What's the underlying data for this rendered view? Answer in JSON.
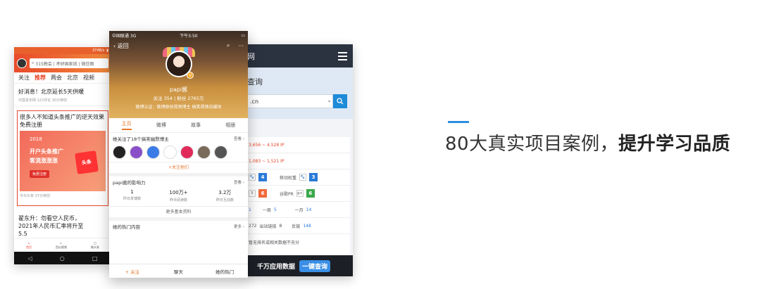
{
  "phone_left": {
    "status_speed": "374B/s",
    "search_text": "315晚会 | 考研国家线 | 微信图",
    "tabs": [
      "关注",
      "推荐",
      "两会",
      "北京",
      "视频"
    ],
    "news1_title": "好消息！北京延长5天供暖",
    "news1_meta": "中国青年网 122评论 30分钟前",
    "ad_title": "很多人不知道头条推广的逆天效果免费注册",
    "ad_year": "2018",
    "ad_line1": "开户头条推广",
    "ad_line2": "客流涨涨涨",
    "ad_button": "免费注册",
    "ad_cube": "头条",
    "ad_meta": "今日头条 37分钟前",
    "news2_title": "翟东升：勿看空人民币，2021年人民币汇率将升至5.5",
    "nav": [
      "首页",
      "西瓜视频",
      "微头条"
    ]
  },
  "phone_front": {
    "status_carrier": "中国联通 3G",
    "status_time": "下午3:50",
    "back_label": "返回",
    "name": "papi酱",
    "stats": "关注 354 | 粉丝 2765万",
    "cert": "微博认证：微博原创视频博主 搞笑视频自媒体",
    "tabs": [
      "主页",
      "微博",
      "故事",
      "相册"
    ],
    "following_title": "她关注了18个搞笑幽默博主",
    "more": "查看",
    "follow_label": "+关注他们",
    "influence_title": "papi酱的影响力",
    "influence": [
      {
        "value": "1",
        "label": "昨日发博数"
      },
      {
        "value": "100万+",
        "label": "昨日阅读数"
      },
      {
        "value": "3.2万",
        "label": "昨日互动数"
      }
    ],
    "more_info": "更多基本资料",
    "hot_title": "她的热门内容",
    "hot_more": "更多",
    "bottom": [
      "+ 关注",
      "聊天",
      "她的热门"
    ]
  },
  "phone_right": {
    "site_title": "网",
    "query_title": "查询",
    "input_value": ".cn",
    "line1": "3,656 ~ 4,528 IP",
    "line2": "1,083 ~ 1,521 IP",
    "weight_a": "4",
    "weight_b_label": "移动权重",
    "weight_b": "3",
    "pr_a": "6",
    "pr_b_label": "谷歌PR",
    "pr_b": "6",
    "week_label": "一周",
    "week_val": "5",
    "month_label": "一月",
    "month_val": "14",
    "links_a": "272",
    "links_b_label": "出站链接",
    "links_b": "8",
    "backlinks_label": "反链",
    "backlinks": "148",
    "note": "暂无排名或相关数据不充分",
    "banner_text": "千万应用数据",
    "banner_btn": "一键查询"
  },
  "tagline": {
    "light": "80大真实项目案例，",
    "bold": "提升学习品质"
  },
  "colors": {
    "accent": "#2e8fe0",
    "toutiao_red": "#e8462c",
    "weibo_orange": "#e8772c"
  }
}
